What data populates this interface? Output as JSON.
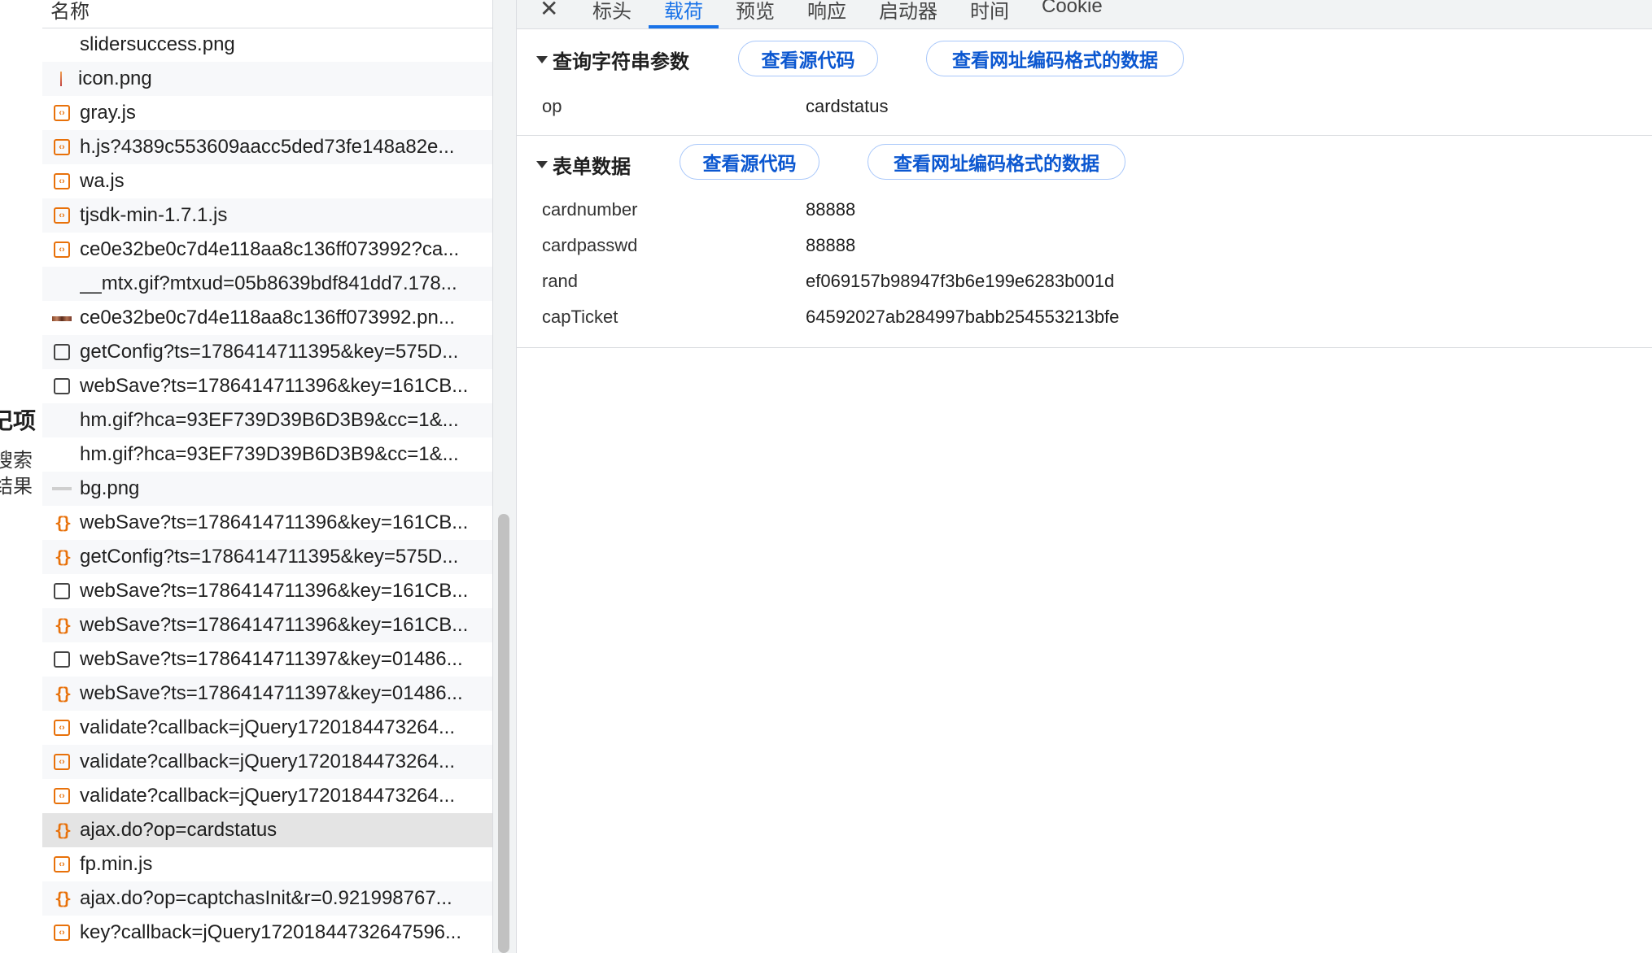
{
  "left_panel": {
    "heading_fragment": "记项",
    "line1_fragment": "搜索",
    "line2_fragment": "结果"
  },
  "request_list": {
    "header": "名称",
    "rows": [
      {
        "name": "slidersuccess.png",
        "icon": "image-icon"
      },
      {
        "name": "icon.png",
        "icon": "image-icon"
      },
      {
        "name": "gray.js",
        "icon": "script-icon"
      },
      {
        "name": "h.js?4389c553609aacc5ded73fe148a82e...",
        "icon": "script-icon"
      },
      {
        "name": "wa.js",
        "icon": "script-icon"
      },
      {
        "name": "tjsdk-min-1.7.1.js",
        "icon": "script-icon"
      },
      {
        "name": "ce0e32be0c7d4e118aa8c136ff073992?ca...",
        "icon": "script-icon"
      },
      {
        "name": "__mtx.gif?mtxud=05b8639bdf841dd7.178...",
        "icon": "image-icon"
      },
      {
        "name": "ce0e32be0c7d4e118aa8c136ff073992.pn...",
        "icon": "image-icon"
      },
      {
        "name": "getConfig?ts=1786414711395&key=575D...",
        "icon": "document-icon"
      },
      {
        "name": "webSave?ts=1786414711396&key=161CB...",
        "icon": "document-icon"
      },
      {
        "name": "hm.gif?hca=93EF739D39B6D3B9&cc=1&...",
        "icon": "image-icon"
      },
      {
        "name": "hm.gif?hca=93EF739D39B6D3B9&cc=1&...",
        "icon": "image-icon"
      },
      {
        "name": "bg.png",
        "icon": "image-icon"
      },
      {
        "name": "webSave?ts=1786414711396&key=161CB...",
        "icon": "xhr-icon"
      },
      {
        "name": "getConfig?ts=1786414711395&key=575D...",
        "icon": "xhr-icon"
      },
      {
        "name": "webSave?ts=1786414711396&key=161CB...",
        "icon": "document-icon"
      },
      {
        "name": "webSave?ts=1786414711396&key=161CB...",
        "icon": "xhr-icon"
      },
      {
        "name": "webSave?ts=1786414711397&key=01486...",
        "icon": "document-icon"
      },
      {
        "name": "webSave?ts=1786414711397&key=01486...",
        "icon": "xhr-icon"
      },
      {
        "name": "validate?callback=jQuery1720184473264...",
        "icon": "script-icon"
      },
      {
        "name": "validate?callback=jQuery1720184473264...",
        "icon": "script-icon"
      },
      {
        "name": "validate?callback=jQuery1720184473264...",
        "icon": "script-icon"
      },
      {
        "name": "ajax.do?op=cardstatus",
        "icon": "xhr-icon",
        "selected": true
      },
      {
        "name": "fp.min.js",
        "icon": "script-icon"
      },
      {
        "name": "ajax.do?op=captchasInit&r=0.921998767...",
        "icon": "xhr-icon"
      },
      {
        "name": "key?callback=jQuery17201844732647596...",
        "icon": "script-icon"
      }
    ]
  },
  "tabs": {
    "close": "✕",
    "items": [
      "标头",
      "载荷",
      "预览",
      "响应",
      "启动器",
      "时间",
      "Cookie"
    ],
    "active": "载荷"
  },
  "query_section": {
    "title": "查询字符串参数",
    "view_source": "查看源代码",
    "view_url_encoded": "查看网址编码格式的数据",
    "params": [
      {
        "key": "op",
        "value": "cardstatus"
      }
    ]
  },
  "form_section": {
    "title": "表单数据",
    "view_source": "查看源代码",
    "view_url_encoded": "查看网址编码格式的数据",
    "params": [
      {
        "key": "cardnumber",
        "value": "88888"
      },
      {
        "key": "cardpasswd",
        "value": "88888"
      },
      {
        "key": "rand",
        "value": "ef069157b98947f3b6e199e6283b001d"
      },
      {
        "key": "capTicket",
        "value": "64592027ab284997babb254553213bfe"
      }
    ]
  },
  "colors": {
    "accent": "#1a73e8",
    "link_button": "#0b57d0",
    "icon_orange": "#e8710a"
  }
}
